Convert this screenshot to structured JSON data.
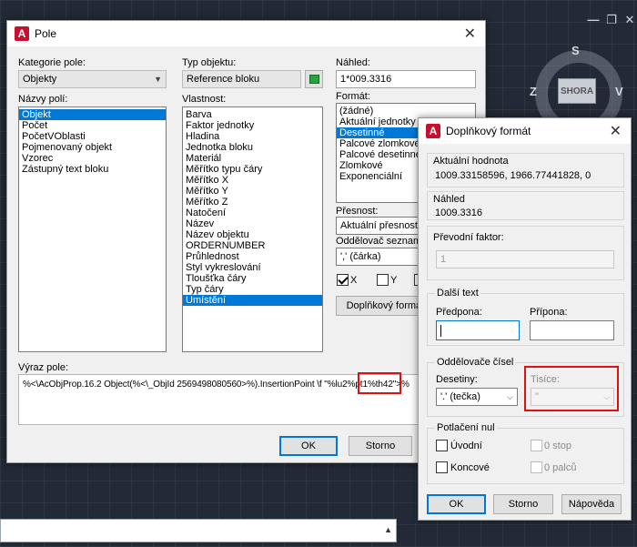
{
  "bg": {
    "viewcube_top": "SHORA",
    "viewcube_west": "Z",
    "viewcube_east": "V",
    "viewcube_south": "S"
  },
  "main": {
    "title": "Pole",
    "category_label": "Kategorie pole:",
    "category_value": "Objekty",
    "fieldnames_label": "Názvy polí:",
    "fieldnames": [
      "Objekt",
      "Počet",
      "PočetVOblasti",
      "Pojmenovaný objekt",
      "Vzorec",
      "Zástupný text bloku"
    ],
    "object_type_label": "Typ objektu:",
    "object_type_value": "Reference bloku",
    "property_label": "Vlastnost:",
    "properties": [
      "Barva",
      "Faktor jednotky",
      "Hladina",
      "Jednotka bloku",
      "Materiál",
      "Měřítko typu čáry",
      "Měřítko X",
      "Měřítko Y",
      "Měřítko Z",
      "Natočení",
      "Název",
      "Název objektu",
      "ORDERNUMBER",
      "Průhlednost",
      "Styl vykreslování",
      "Tloušťka čáry",
      "Typ čáry",
      "Umístění"
    ],
    "preview_label": "Náhled:",
    "preview_value": "1*009.3316",
    "format_label": "Formát:",
    "formats": [
      "(žádné)",
      "Aktuální jednotky",
      "Desetinné",
      "Palcové zlomkové",
      "Palcové desetinné",
      "Zlomkové",
      "Exponenciální"
    ],
    "precision_label": "Přesnost:",
    "precision_value": "Aktuální přesnost",
    "separator_label": "Oddělovač seznamu:",
    "separator_value": "',' (čárka)",
    "x_label": "X",
    "y_label": "Y",
    "extra_format_button": "Doplňkový formát...",
    "expression_label": "Výraz pole:",
    "expression_pre": "%<\\AcObjProp.16.2 Object(%<\\_ObjId 2569498080560>%).InsertionPoint \\f \"%lu2%pt1%th42\">%",
    "ok": "OK",
    "cancel": "Storno"
  },
  "extra": {
    "title": "Doplňkový formát",
    "current_value_label": "Aktuální hodnota",
    "current_value": "1009.33158596, 1966.77441828, 0",
    "preview_label": "Náhled",
    "preview_value": "1009.3316",
    "conversion_label": "Převodní faktor:",
    "conversion_value": "1",
    "additional_text_label": "Další text",
    "prefix_label": "Předpona:",
    "suffix_label": "Přípona:",
    "number_sep_label": "Oddělovače čísel",
    "decimal_label": "Desetiny:",
    "decimal_value": "'.' (tečka)",
    "thousands_label": "Tisíce:",
    "thousands_value": "\"",
    "zero_suppression_label": "Potlačení nul",
    "leading_label": "Úvodní",
    "trailing_label": "Koncové",
    "zero_feet_label": "0 stop",
    "zero_inches_label": "0 palců",
    "ok": "OK",
    "cancel": "Storno",
    "help": "Nápověda"
  }
}
